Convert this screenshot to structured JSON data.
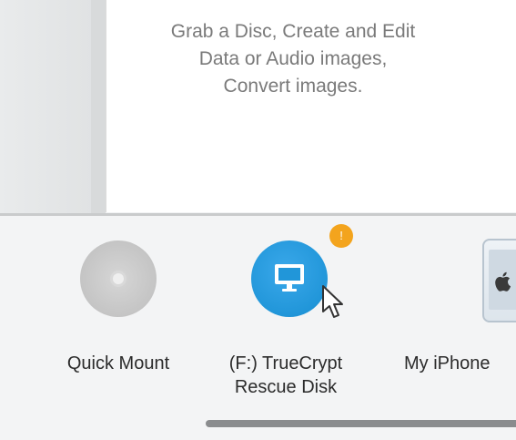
{
  "description": {
    "line1": "Grab a Disc, Create and Edit",
    "line2": "Data or Audio images,",
    "line3": "Convert images."
  },
  "devices": [
    {
      "label_line1": "Quick Mount",
      "label_line2": "",
      "icon": "disc-icon"
    },
    {
      "label_line1": "(F:) TrueCrypt",
      "label_line2": "Rescue Disk",
      "icon": "monitor-icon",
      "badge": "!"
    },
    {
      "label_line1": "My iPhone",
      "label_line2": "",
      "icon": "iphone-icon"
    }
  ],
  "colors": {
    "accent_blue": "#2196d9",
    "badge_orange": "#f3a41d",
    "text_gray": "#7a7a7a"
  }
}
